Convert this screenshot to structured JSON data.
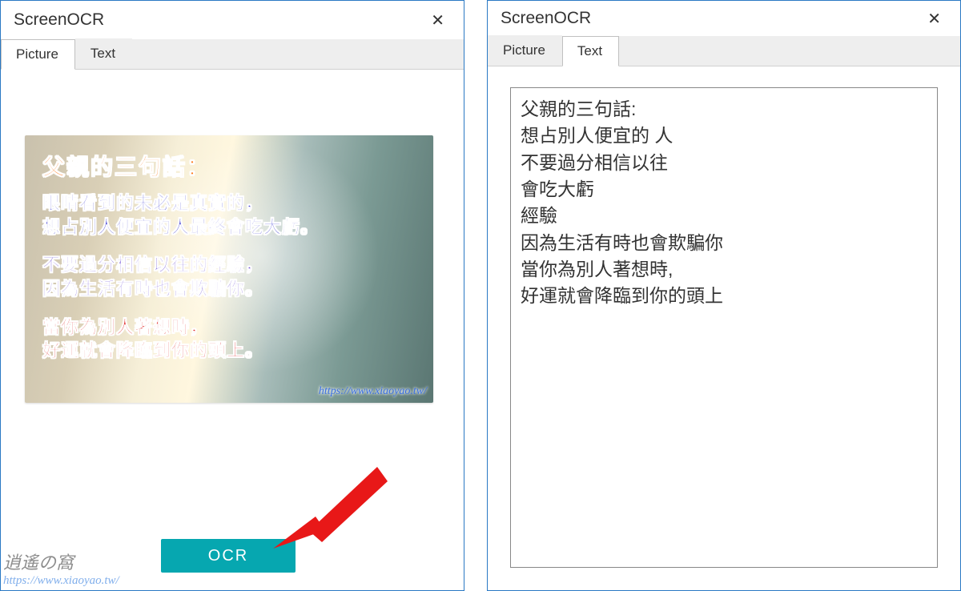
{
  "left_window": {
    "title": "ScreenOCR",
    "tabs": {
      "picture": "Picture",
      "text": "Text"
    },
    "active_tab": "Picture",
    "ocr_button_label": "OCR",
    "image_text": {
      "title": "父親的三句話：",
      "line1a": "眼睛看到的未必是真實的，",
      "line1b": "想占別人便宜的人最終會吃大虧。",
      "line2a": "不要過分相信以往的經驗，",
      "line2b": "因為生活有時也會欺騙你。",
      "line3a": "當你為別人著想時，",
      "line3b": "好運就會降臨到你的頭上。",
      "url": "https://www.xiaoyao.tw/"
    }
  },
  "right_window": {
    "title": "ScreenOCR",
    "tabs": {
      "picture": "Picture",
      "text": "Text"
    },
    "active_tab": "Text",
    "ocr_output": "父親的三句話:\n想占別人便宜的 人\n不要過分相信以往\n會吃大虧\n經驗\n因為生活有時也會欺騙你\n當你為別人著想時,\n好運就會降臨到你的頭上"
  },
  "watermark": {
    "site_name": "逍遙の窩",
    "url": "https://www.xiaoyao.tw/"
  }
}
